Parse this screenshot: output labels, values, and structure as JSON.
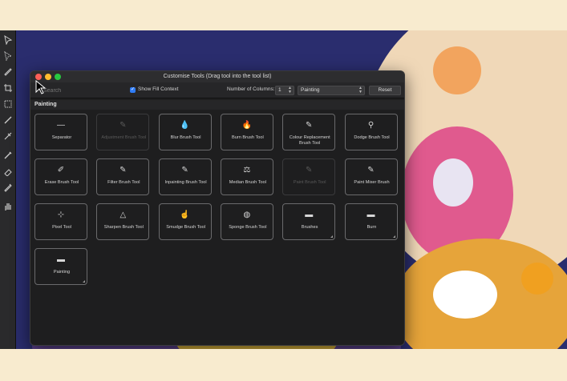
{
  "dialog": {
    "title": "Customise Tools (Drag tool into the tool list)",
    "search_placeholder": "Search",
    "show_fill_context_label": "Show Fill Context",
    "show_fill_context_checked": true,
    "columns_label": "Number of Columns:",
    "columns_value": "1",
    "category_value": "Painting",
    "reset_label": "Reset",
    "section_title": "Painting"
  },
  "colors": {
    "close": "#fe5f57",
    "minimize": "#febc2e",
    "zoom": "#28c840",
    "accent": "#2f7cf6"
  },
  "tools": [
    {
      "label": "Separator",
      "icon": "separator-icon",
      "glyph": "—",
      "disabled": false,
      "group": false
    },
    {
      "label": "Adjustment Brush Tool",
      "icon": "adjustment-brush-icon",
      "glyph": "✎",
      "disabled": true,
      "group": false
    },
    {
      "label": "Blur Brush Tool",
      "icon": "blur-brush-icon",
      "glyph": "💧",
      "disabled": false,
      "group": false
    },
    {
      "label": "Burn Brush Tool",
      "icon": "burn-brush-icon",
      "glyph": "🔥",
      "disabled": false,
      "group": false
    },
    {
      "label": "Colour Replacement Brush Tool",
      "icon": "colour-replacement-brush-icon",
      "glyph": "✎",
      "disabled": false,
      "group": false
    },
    {
      "label": "Dodge Brush Tool",
      "icon": "dodge-brush-icon",
      "glyph": "⚲",
      "disabled": false,
      "group": false
    },
    {
      "label": "Erase Brush Tool",
      "icon": "erase-brush-icon",
      "glyph": "✐",
      "disabled": false,
      "group": false
    },
    {
      "label": "Filter Brush Tool",
      "icon": "filter-brush-icon",
      "glyph": "✎",
      "disabled": false,
      "group": false
    },
    {
      "label": "Inpainting Brush Tool",
      "icon": "inpainting-brush-icon",
      "glyph": "✎",
      "disabled": false,
      "group": false
    },
    {
      "label": "Median Brush Tool",
      "icon": "median-brush-icon",
      "glyph": "⚖",
      "disabled": false,
      "group": false
    },
    {
      "label": "Paint Brush Tool",
      "icon": "paint-brush-icon",
      "glyph": "✎",
      "disabled": true,
      "group": false
    },
    {
      "label": "Paint Mixer Brush",
      "icon": "paint-mixer-brush-icon",
      "glyph": "✎",
      "disabled": false,
      "group": false
    },
    {
      "label": "Pixel Tool",
      "icon": "pixel-tool-icon",
      "glyph": "⊹",
      "disabled": false,
      "group": false
    },
    {
      "label": "Sharpen Brush Tool",
      "icon": "sharpen-brush-icon",
      "glyph": "△",
      "disabled": false,
      "group": false
    },
    {
      "label": "Smudge Brush Tool",
      "icon": "smudge-brush-icon",
      "glyph": "☝",
      "disabled": false,
      "group": false
    },
    {
      "label": "Sponge Brush Tool",
      "icon": "sponge-brush-icon",
      "glyph": "◍",
      "disabled": false,
      "group": false
    },
    {
      "label": "Brushes",
      "icon": "folder-icon",
      "glyph": "▬",
      "disabled": false,
      "group": true
    },
    {
      "label": "Burn",
      "icon": "folder-icon",
      "glyph": "▬",
      "disabled": false,
      "group": true
    },
    {
      "label": "Painting",
      "icon": "folder-icon",
      "glyph": "▬",
      "disabled": false,
      "group": true
    }
  ],
  "toolbar_icons": [
    "move-icon",
    "select-icon",
    "pen-icon",
    "crop-icon",
    "transform-icon",
    "brush-icon",
    "eyedropper-icon",
    "paint-brush-icon",
    "eraser-icon",
    "hand-icon"
  ]
}
